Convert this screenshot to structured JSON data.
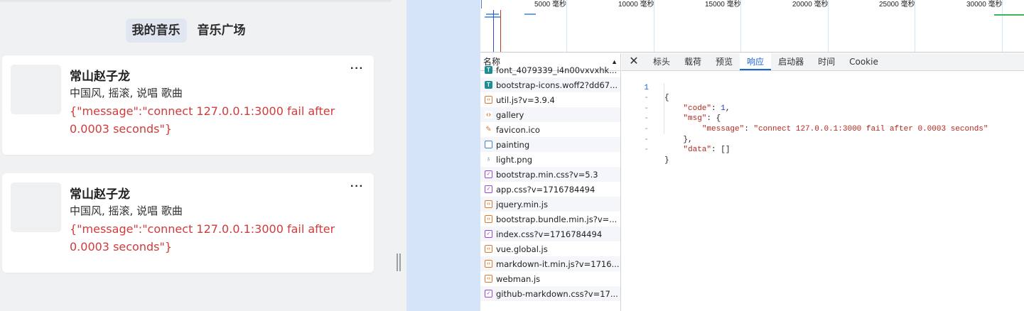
{
  "app": {
    "tabs": [
      {
        "label": "我的音乐",
        "active": true
      },
      {
        "label": "音乐广场",
        "active": false
      }
    ],
    "cards": [
      {
        "title": "常山赵子龙",
        "tags": "中国风, 摇滚, 说唱 歌曲",
        "error": "{\"message\":\"connect 127.0.0.1:3000 fail after 0.0003 seconds\"}",
        "more_label": "···"
      },
      {
        "title": "常山赵子龙",
        "tags": "中国风, 摇滚, 说唱 歌曲",
        "error": "{\"message\":\"connect 127.0.0.1:3000 fail after 0.0003 seconds\"}",
        "more_label": "···"
      }
    ]
  },
  "devtools": {
    "timeline": {
      "ticks": [
        "5000 毫秒",
        "10000 毫秒",
        "15000 毫秒",
        "20000 毫秒",
        "25000 毫秒",
        "30000 毫秒"
      ]
    },
    "name_header": "名称",
    "requests": [
      {
        "name": "font_4079339_i4n00vxvxhk...",
        "icon": "font-icon",
        "glyph": "T"
      },
      {
        "name": "bootstrap-icons.woff2?dd67...",
        "icon": "font-icon",
        "glyph": "T"
      },
      {
        "name": "util.js?v=3.9.4",
        "icon": "script-icon",
        "glyph": "‹›"
      },
      {
        "name": "gallery",
        "icon": "document-icon",
        "glyph": "‹›"
      },
      {
        "name": "favicon.ico",
        "icon": "image-icon",
        "glyph": "✎"
      },
      {
        "name": "painting",
        "icon": "page-icon",
        "glyph": ""
      },
      {
        "name": "light.png",
        "icon": "png-icon",
        "glyph": "♁"
      },
      {
        "name": "bootstrap.min.css?v=5.3",
        "icon": "stylesheet-icon",
        "glyph": "✓"
      },
      {
        "name": "app.css?v=1716784494",
        "icon": "stylesheet-icon",
        "glyph": "✓"
      },
      {
        "name": "jquery.min.js",
        "icon": "script-icon",
        "glyph": "‹›"
      },
      {
        "name": "bootstrap.bundle.min.js?v=...",
        "icon": "script-icon",
        "glyph": "‹›"
      },
      {
        "name": "index.css?v=1716784494",
        "icon": "stylesheet-icon",
        "glyph": "✓"
      },
      {
        "name": "vue.global.js",
        "icon": "script-icon",
        "glyph": "‹›"
      },
      {
        "name": "markdown-it.min.js?v=1716...",
        "icon": "script-icon",
        "glyph": "‹›"
      },
      {
        "name": "webman.js",
        "icon": "script-icon",
        "glyph": "‹›"
      },
      {
        "name": "github-markdown.css?v=17...",
        "icon": "stylesheet-icon",
        "glyph": "✓"
      }
    ],
    "detail_tabs": [
      {
        "label": "标头",
        "active": false
      },
      {
        "label": "载荷",
        "active": false
      },
      {
        "label": "预览",
        "active": false
      },
      {
        "label": "响应",
        "active": true
      },
      {
        "label": "启动器",
        "active": false
      },
      {
        "label": "时间",
        "active": false
      },
      {
        "label": "Cookie",
        "active": false
      }
    ],
    "close_label": "✕",
    "response": {
      "gutter": [
        "1",
        "-",
        "-",
        "-",
        "-",
        "-",
        "-"
      ],
      "code": 1,
      "message": "connect 127.0.0.1:3000 fail after 0.0003 seconds"
    }
  },
  "colors": {
    "error_text": "#d13b3b",
    "active_tab_blue": "#1a66d1",
    "left_bg": "#f0f1f3",
    "blue_pane": "#d6e4f7"
  }
}
